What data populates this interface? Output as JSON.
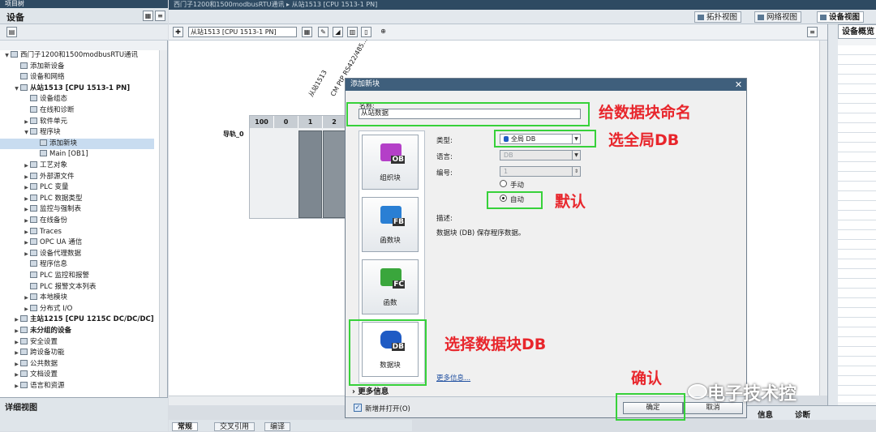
{
  "project_panel": {
    "header": "项目树",
    "tab": "设备",
    "tree": [
      {
        "label": "西门子1200和1500modbusRTU通讯",
        "depth": 0,
        "expanded": true
      },
      {
        "label": "添加新设备",
        "depth": 1
      },
      {
        "label": "设备和网络",
        "depth": 1
      },
      {
        "label": "从站1513 [CPU 1513-1 PN]",
        "depth": 1,
        "expanded": true,
        "bold": true
      },
      {
        "label": "设备组态",
        "depth": 2
      },
      {
        "label": "在线和诊断",
        "depth": 2
      },
      {
        "label": "软件单元",
        "depth": 2,
        "collapsed": true
      },
      {
        "label": "程序块",
        "depth": 2,
        "expanded": true
      },
      {
        "label": "添加新块",
        "depth": 3,
        "selected": true
      },
      {
        "label": "Main [OB1]",
        "depth": 3
      },
      {
        "label": "工艺对象",
        "depth": 2,
        "collapsed": true
      },
      {
        "label": "外部源文件",
        "depth": 2,
        "collapsed": true
      },
      {
        "label": "PLC 变量",
        "depth": 2,
        "collapsed": true
      },
      {
        "label": "PLC 数据类型",
        "depth": 2,
        "collapsed": true
      },
      {
        "label": "监控与强制表",
        "depth": 2,
        "collapsed": true
      },
      {
        "label": "在线备份",
        "depth": 2,
        "collapsed": true
      },
      {
        "label": "Traces",
        "depth": 2,
        "collapsed": true
      },
      {
        "label": "OPC UA 通信",
        "depth": 2,
        "collapsed": true
      },
      {
        "label": "设备代理数据",
        "depth": 2,
        "collapsed": true
      },
      {
        "label": "程序信息",
        "depth": 2
      },
      {
        "label": "PLC 监控和报警",
        "depth": 2
      },
      {
        "label": "PLC 报警文本列表",
        "depth": 2
      },
      {
        "label": "本地模块",
        "depth": 2,
        "collapsed": true
      },
      {
        "label": "分布式 I/O",
        "depth": 2,
        "collapsed": true
      },
      {
        "label": "主站1215 [CPU 1215C DC/DC/DC]",
        "depth": 1,
        "collapsed": true,
        "bold": true
      },
      {
        "label": "未分组的设备",
        "depth": 1,
        "collapsed": true,
        "bold": true
      },
      {
        "label": "安全设置",
        "depth": 1,
        "collapsed": true
      },
      {
        "label": "跨设备功能",
        "depth": 1,
        "collapsed": true
      },
      {
        "label": "公共数据",
        "depth": 1,
        "collapsed": true
      },
      {
        "label": "文档设置",
        "depth": 1,
        "collapsed": true
      },
      {
        "label": "语言和资源",
        "depth": 1,
        "collapsed": true
      }
    ],
    "detail_view": "详细视图"
  },
  "title_strip": "西门子1200和1500modbusRTU通讯 ▸ 从站1513 [CPU 1513-1 PN]",
  "view_tabs": [
    {
      "label": "拓扑视图",
      "active": false
    },
    {
      "label": "网络视图",
      "active": false
    },
    {
      "label": "设备视图",
      "active": true
    }
  ],
  "device_selector": "从站1513 [CPU 1513-1 PN]",
  "rack": {
    "rail_label": "导轨_0",
    "slots": [
      "100",
      "0",
      "1",
      "2"
    ],
    "module_labels": [
      "从站1513",
      "CM PtP RS422/485..."
    ]
  },
  "right_panel_tab": "设备概览",
  "bottom_tabs": [
    "常规",
    "交叉引用",
    "编译"
  ],
  "info_bar": {
    "info": "信息",
    "diag": "诊断"
  },
  "dialog": {
    "title": "添加新块",
    "name_label": "名称:",
    "name_value": "从站数据",
    "block_types": [
      {
        "code": "OB",
        "label": "组织块",
        "color": "#b43fc8"
      },
      {
        "code": "FB",
        "label": "函数块",
        "color": "#2a7fd4"
      },
      {
        "code": "FC",
        "label": "函数",
        "color": "#3aa63c"
      },
      {
        "code": "DB",
        "label": "数据块",
        "color": "#1f5bc4"
      }
    ],
    "type_label": "类型:",
    "type_value": "全局 DB",
    "language_label": "语言:",
    "language_value": "DB",
    "number_label": "编号:",
    "number_value": "1",
    "manual_label": "手动",
    "auto_label": "自动",
    "desc_label": "描述:",
    "desc_text": "数据块 (DB) 保存程序数据。",
    "more_info_link": "更多信息...",
    "more_section": "更多信息",
    "add_open_label": "新增并打开(O)",
    "ok_label": "确定",
    "cancel_label": "取消"
  },
  "annotations": {
    "name_block": "给数据块命名",
    "select_global": "选全局DB",
    "default": "默认",
    "select_db": "选择数据块DB",
    "confirm": "确认"
  },
  "watermark": "电子技术控"
}
